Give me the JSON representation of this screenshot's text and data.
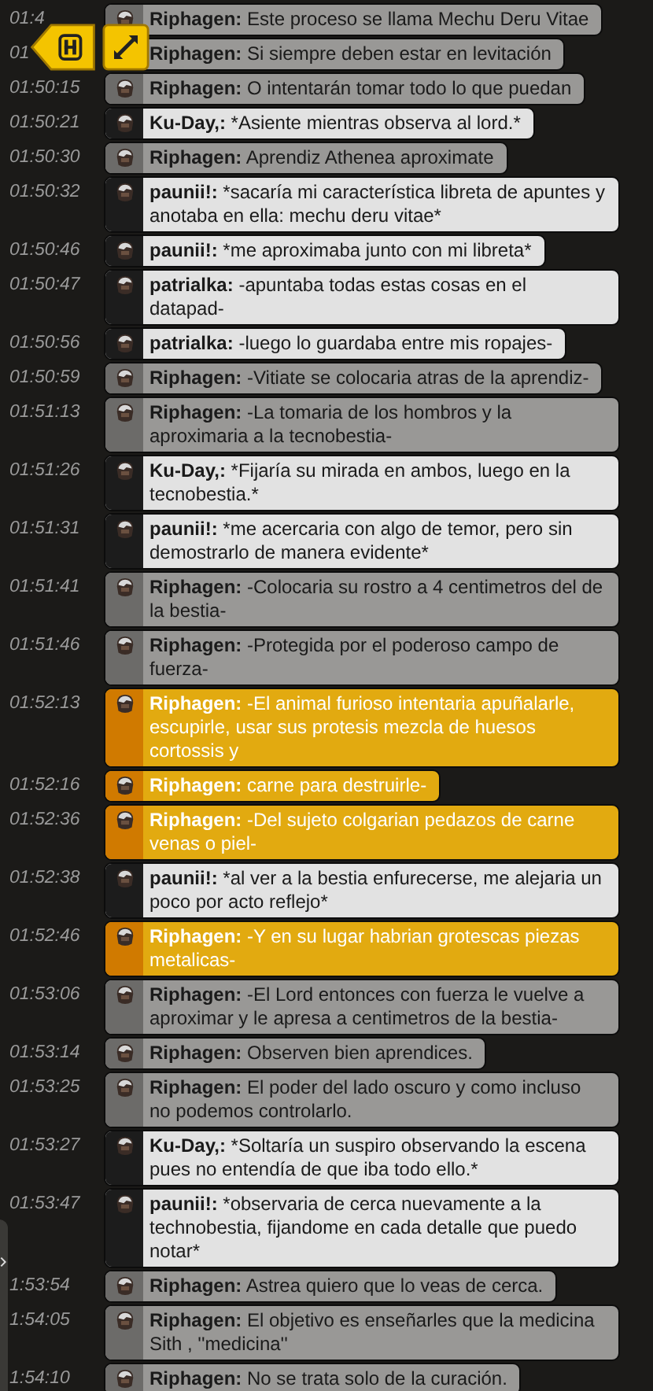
{
  "messages": [
    {
      "time": "01:4",
      "user": "Riphagen:",
      "text": "Este proceso se llama Mechu Deru Vitae",
      "kind": "self"
    },
    {
      "time": "01",
      "user": "Riphagen:",
      "text": "Si siempre deben estar en levitación",
      "kind": "self"
    },
    {
      "time": "01:50:15",
      "user": "Riphagen:",
      "text": "O intentarán tomar todo lo que puedan",
      "kind": "self"
    },
    {
      "time": "01:50:21",
      "user": "Ku-Day,:",
      "text": "*Asiente mientras observa al lord.*",
      "kind": "other"
    },
    {
      "time": "01:50:30",
      "user": "Riphagen:",
      "text": "Aprendiz Athenea aproximate",
      "kind": "self"
    },
    {
      "time": "01:50:32",
      "user": "paunii!:",
      "text": "*sacaría mi característica libreta de apuntes y anotaba en ella: mechu deru vitae*",
      "kind": "other"
    },
    {
      "time": "01:50:46",
      "user": "paunii!:",
      "text": "*me aproximaba junto con mi libreta*",
      "kind": "other"
    },
    {
      "time": "01:50:47",
      "user": "patrialka:",
      "text": "-apuntaba todas estas cosas en el datapad-",
      "kind": "other"
    },
    {
      "time": "01:50:56",
      "user": "patrialka:",
      "text": "-luego lo guardaba entre mis ropajes-",
      "kind": "other"
    },
    {
      "time": "01:50:59",
      "user": "Riphagen:",
      "text": "-Vitiate se colocaria atras de la aprendiz-",
      "kind": "self"
    },
    {
      "time": "01:51:13",
      "user": "Riphagen:",
      "text": "-La tomaria de los hombros y la aproximaria a la tecnobestia-",
      "kind": "self"
    },
    {
      "time": "01:51:26",
      "user": "Ku-Day,:",
      "text": "*Fijaría su mirada en ambos, luego en la tecnobestia.*",
      "kind": "other"
    },
    {
      "time": "01:51:31",
      "user": "paunii!:",
      "text": "*me acercaria con algo de temor, pero sin demostrarlo de manera evidente*",
      "kind": "other"
    },
    {
      "time": "01:51:41",
      "user": "Riphagen:",
      "text": "-Colocaria su rostro a 4 centimetros del de la bestia-",
      "kind": "self"
    },
    {
      "time": "01:51:46",
      "user": "Riphagen:",
      "text": "-Protegida por el poderoso campo de fuerza-",
      "kind": "self"
    },
    {
      "time": "01:52:13",
      "user": "Riphagen:",
      "text": "-El animal furioso intentaria apuñalarle, escupirle, usar sus protesis mezcla de huesos cortossis y",
      "kind": "highlight"
    },
    {
      "time": "01:52:16",
      "user": "Riphagen:",
      "text": "carne para destruirle-",
      "kind": "highlight"
    },
    {
      "time": "01:52:36",
      "user": "Riphagen:",
      "text": "-Del sujeto colgarian pedazos de carne venas o piel-",
      "kind": "highlight"
    },
    {
      "time": "01:52:38",
      "user": "paunii!:",
      "text": "*al ver a la bestia enfurecerse, me alejaria un poco por acto reflejo*",
      "kind": "other"
    },
    {
      "time": "01:52:46",
      "user": "Riphagen:",
      "text": "-Y en su lugar habrian grotescas piezas metalicas-",
      "kind": "highlight"
    },
    {
      "time": "01:53:06",
      "user": "Riphagen:",
      "text": "-El Lord entonces con fuerza le vuelve a aproximar y le apresa a centimetros de la bestia-",
      "kind": "self"
    },
    {
      "time": "01:53:14",
      "user": "Riphagen:",
      "text": "Observen bien aprendices.",
      "kind": "self"
    },
    {
      "time": "01:53:25",
      "user": "Riphagen:",
      "text": "El poder del lado oscuro y como incluso no podemos controlarlo.",
      "kind": "self"
    },
    {
      "time": "01:53:27",
      "user": "Ku-Day,:",
      "text": "*Soltaría un suspiro observando la escena pues no entendía de que iba todo ello.*",
      "kind": "other"
    },
    {
      "time": "01:53:47",
      "user": "paunii!:",
      "text": "*observaria de cerca nuevamente a la technobestia, fijandome en cada detalle que puedo notar*",
      "kind": "other"
    },
    {
      "time": "1:53:54",
      "user": "Riphagen:",
      "text": "Astrea quiero que lo veas de cerca.",
      "kind": "self"
    },
    {
      "time": "1:54:05",
      "user": "Riphagen:",
      "text": "El objetivo es enseñarles que la medicina Sith , ''medicina''",
      "kind": "self"
    },
    {
      "time": "1:54:10",
      "user": "Riphagen:",
      "text": "No se trata solo de la curación.",
      "kind": "self"
    }
  ]
}
